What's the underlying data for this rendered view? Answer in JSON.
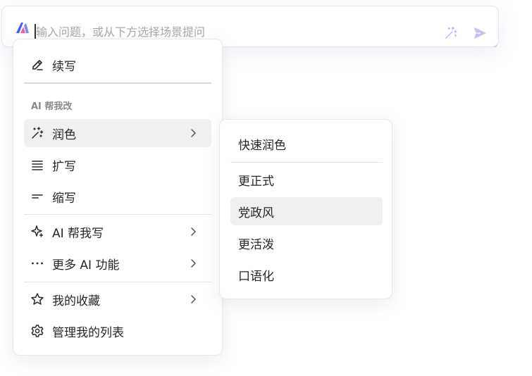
{
  "prompt": {
    "placeholder": "输入问题，或从下方选择场景提问",
    "icons": [
      "logo-icon",
      "magic-wand-icon",
      "send-icon"
    ],
    "accent": "#c9b6ff"
  },
  "menu": {
    "continue_label": "续写",
    "section_title": "AI 帮我改",
    "polish_label": "润色",
    "expand_label": "扩写",
    "shorten_label": "缩写",
    "ai_write_label": "AI 帮我写",
    "more_ai_label": "更多 AI 功能",
    "favorites_label": "我的收藏",
    "manage_label": "管理我的列表",
    "active_item": "润色"
  },
  "submenu": {
    "items": [
      "快速润色",
      "更正式",
      "党政风",
      "更活泼",
      "口语化"
    ],
    "active_item": "党政风"
  }
}
